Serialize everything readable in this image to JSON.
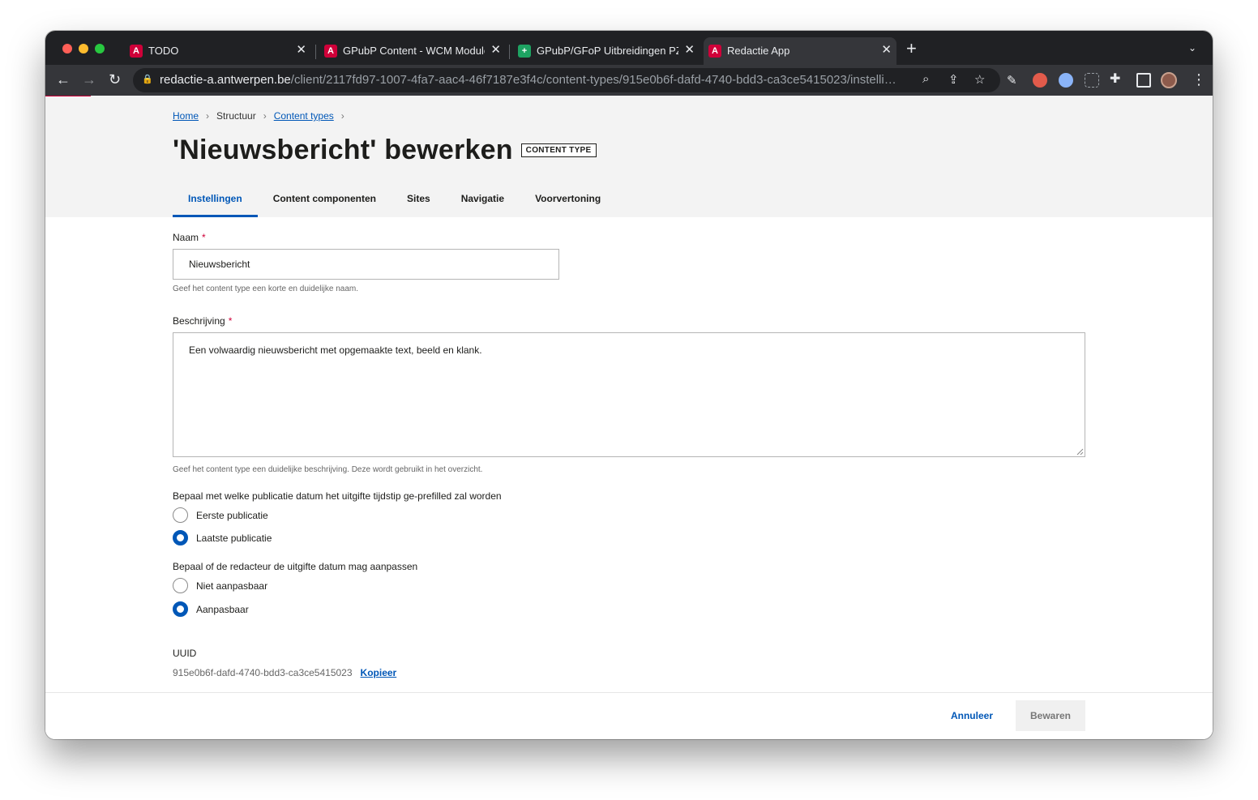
{
  "browser": {
    "tabs": [
      {
        "label": "TODO",
        "favicon": "antwerpen-a-icon",
        "active": false
      },
      {
        "label": "GPubP Content - WCM Module",
        "favicon": "antwerpen-a-icon",
        "active": false
      },
      {
        "label": "GPubP/GFoP Uitbreidingen PZA",
        "favicon": "google-sheets-icon",
        "active": false
      },
      {
        "label": "Redactie App",
        "favicon": "antwerpen-a-icon",
        "active": true
      }
    ],
    "url_host": "redactie-a.antwerpen.be",
    "url_path": "/client/2117fd97-1007-4fa7-aac4-46f7187e3f4c/content-types/915e0b6f-dafd-4740-bdd3-ca3ce5415023/instelli…"
  },
  "breadcrumb": {
    "home": "Home",
    "structure": "Structuur",
    "content_types": "Content types"
  },
  "header": {
    "title": "'Nieuwsbericht' bewerken",
    "badge": "CONTENT TYPE"
  },
  "tabs": [
    "Instellingen",
    "Content componenten",
    "Sites",
    "Navigatie",
    "Voorvertoning"
  ],
  "form": {
    "name_label": "Naam",
    "required_mark": "*",
    "name_value": "Nieuwsbericht",
    "name_help": "Geef het content type een korte en duidelijke naam.",
    "description_label": "Beschrijving",
    "description_value": "Een volwaardig nieuwsbericht met opgemaakte text, beeld en klank.",
    "description_help": "Geef het content type een duidelijke beschrijving. Deze wordt gebruikt in het overzicht.",
    "publication_question": "Bepaal met welke publicatie datum het uitgifte tijdstip ge-prefilled zal worden",
    "publication_options": [
      "Eerste publicatie",
      "Laatste publicatie"
    ],
    "publication_selected": "Laatste publicatie",
    "editable_question": "Bepaal of de redacteur de uitgifte datum mag aanpassen",
    "editable_options": [
      "Niet aanpasbaar",
      "Aanpasbaar"
    ],
    "editable_selected": "Aanpasbaar",
    "uuid_label": "UUID",
    "uuid_value": "915e0b6f-dafd-4740-bdd3-ca3ce5415023",
    "copy_label": "Kopieer"
  },
  "footer": {
    "cancel_label": "Annuleer",
    "save_label": "Bewaren"
  },
  "colors": {
    "accent": "#0057b7",
    "brand_red": "#cf0039",
    "header_band": "#f3f3f3"
  }
}
